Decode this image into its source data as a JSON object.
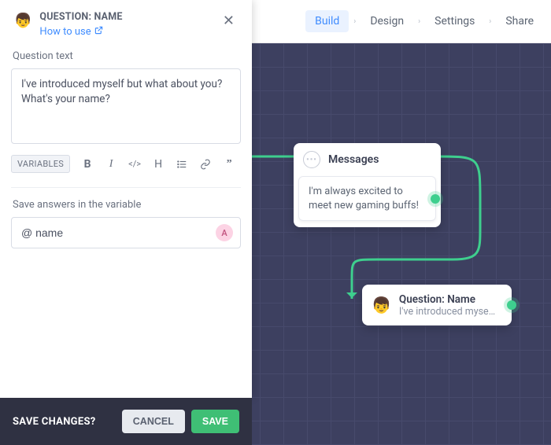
{
  "nav": {
    "tabs": [
      "Build",
      "Design",
      "Settings",
      "Share"
    ],
    "active_index": 0
  },
  "panel": {
    "emoji": "👦",
    "title": "QUESTION: NAME",
    "how_to_use": "How to use",
    "close_glyph": "✕",
    "question_text_label": "Question text",
    "question_text_value": "I've introduced myself but what about you? What's your name?",
    "variables_btn": "VARIABLES",
    "toolbar_icons": {
      "bold": "B",
      "italic": "I",
      "code": "</>",
      "heading": "H",
      "list": "≡",
      "link": "🔗",
      "quote": "❝❞"
    },
    "save_var_label": "Save answers in the variable",
    "var_value": "@ name",
    "var_badge": "A"
  },
  "savebar": {
    "question": "SAVE CHANGES?",
    "cancel": "CANCEL",
    "save": "SAVE"
  },
  "canvas": {
    "messages_node": {
      "title": "Messages",
      "body": "I'm always excited to meet new gaming buffs!"
    },
    "question_node": {
      "emoji": "👦",
      "title": "Question: Name",
      "subtitle": "I've introduced myse…"
    }
  }
}
